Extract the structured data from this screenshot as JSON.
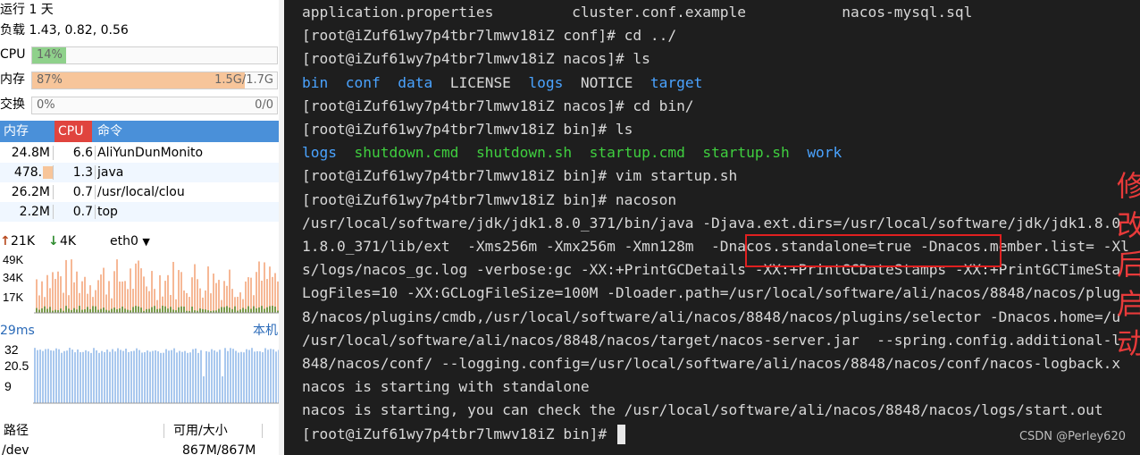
{
  "sysinfo": {
    "uptime": "运行 1 天",
    "load": "负载 1.43, 0.82, 0.56"
  },
  "meters": {
    "cpu": {
      "label": "CPU",
      "value": "14%",
      "fraction": 0.14,
      "color": "#8fd18b"
    },
    "mem": {
      "label": "内存",
      "value": "87%",
      "fraction": 0.87,
      "usage": "1.5G/1.7G",
      "color": "#f7c59a"
    },
    "swap": {
      "label": "交换",
      "value": "0%",
      "fraction": 0.0,
      "usage": "0/0",
      "color": "#cccccc"
    }
  },
  "processes": {
    "headers": {
      "mem": "内存",
      "cpu": "CPU",
      "cmd": "命令"
    },
    "rows": [
      {
        "mem": "24.8M",
        "cpu": "6.6",
        "cmd": "AliYunDunMonito"
      },
      {
        "mem": "478.5",
        "cpu": "1.3",
        "cmd": "java"
      },
      {
        "mem": "26.2M",
        "cpu": "0.7",
        "cmd": "/usr/local/clou"
      },
      {
        "mem": "2.2M",
        "cpu": "0.7",
        "cmd": "top"
      }
    ]
  },
  "network": {
    "up": "21K",
    "down": "4K",
    "interface": "eth0",
    "up_arrow_color": "#b84a1f",
    "down_arrow_color": "#2e8b2e",
    "y_ticks": [
      "49K",
      "34K",
      "17K"
    ]
  },
  "ping": {
    "latency": "29ms",
    "target": "本机",
    "y_ticks": [
      "32",
      "20.5",
      "9"
    ]
  },
  "disk": {
    "headers": {
      "path": "路径",
      "size": "可用/大小"
    },
    "row": {
      "path": "/dev",
      "size": "867M/867M"
    }
  },
  "terminal": {
    "lines": [
      {
        "segments": [
          {
            "t": "application.properties         cluster.conf.example           nacos-mysql.sql",
            "c": ""
          }
        ]
      },
      {
        "segments": [
          {
            "t": "[root@iZuf61wy7p4tbr7lmwv18iZ conf]# cd ../",
            "c": ""
          }
        ]
      },
      {
        "segments": [
          {
            "t": "[root@iZuf61wy7p4tbr7lmwv18iZ nacos]# ls",
            "c": ""
          }
        ]
      },
      {
        "segments": [
          {
            "t": "bin",
            "c": "c-blue"
          },
          {
            "t": "  ",
            "c": ""
          },
          {
            "t": "conf",
            "c": "c-blue"
          },
          {
            "t": "  ",
            "c": ""
          },
          {
            "t": "data",
            "c": "c-blue"
          },
          {
            "t": "  LICENSE  ",
            "c": ""
          },
          {
            "t": "logs",
            "c": "c-blue"
          },
          {
            "t": "  NOTICE  ",
            "c": ""
          },
          {
            "t": "target",
            "c": "c-blue"
          }
        ]
      },
      {
        "segments": [
          {
            "t": "[root@iZuf61wy7p4tbr7lmwv18iZ nacos]# cd bin/",
            "c": ""
          }
        ]
      },
      {
        "segments": [
          {
            "t": "[root@iZuf61wy7p4tbr7lmwv18iZ bin]# ls",
            "c": ""
          }
        ]
      },
      {
        "segments": [
          {
            "t": "logs",
            "c": "c-blue"
          },
          {
            "t": "  ",
            "c": ""
          },
          {
            "t": "shutdown.cmd",
            "c": "c-green"
          },
          {
            "t": "  ",
            "c": ""
          },
          {
            "t": "shutdown.sh",
            "c": "c-green"
          },
          {
            "t": "  ",
            "c": ""
          },
          {
            "t": "startup.cmd",
            "c": "c-green"
          },
          {
            "t": "  ",
            "c": ""
          },
          {
            "t": "startup.sh",
            "c": "c-green"
          },
          {
            "t": "  ",
            "c": ""
          },
          {
            "t": "work",
            "c": "c-blue"
          }
        ]
      },
      {
        "segments": [
          {
            "t": "[root@iZuf61wy7p4tbr7lmwv18iZ bin]# vim startup.sh",
            "c": ""
          }
        ]
      },
      {
        "segments": [
          {
            "t": "[root@iZuf61wy7p4tbr7lmwv18iZ bin]# nacoson",
            "c": ""
          }
        ]
      },
      {
        "segments": [
          {
            "t": "/usr/local/software/jdk/jdk1.8.0_371/bin/java -Djava.ext.dirs=/usr/local/software/jdk/jdk1.8.0",
            "c": ""
          }
        ]
      },
      {
        "segments": [
          {
            "t": "1.8.0_371/lib/ext  -Xms256m -Xmx256m -Xmn128m  -Dnacos.standalone=true -Dnacos.member.list= -Xl",
            "c": ""
          }
        ]
      },
      {
        "segments": [
          {
            "t": "s/logs/nacos_gc.log -verbose:gc -XX:+PrintGCDetails -XX:+PrintGCDateStamps -XX:+PrintGCTimeSta",
            "c": ""
          }
        ]
      },
      {
        "segments": [
          {
            "t": "LogFiles=10 -XX:GCLogFileSize=100M -Dloader.path=/usr/local/software/ali/nacos/8848/nacos/plug",
            "c": ""
          }
        ]
      },
      {
        "segments": [
          {
            "t": "8/nacos/plugins/cmdb,/usr/local/software/ali/nacos/8848/nacos/plugins/selector -Dnacos.home=/u",
            "c": ""
          }
        ]
      },
      {
        "segments": [
          {
            "t": "/usr/local/software/ali/nacos/8848/nacos/target/nacos-server.jar  --spring.config.additional-l",
            "c": ""
          }
        ]
      },
      {
        "segments": [
          {
            "t": "848/nacos/conf/ --logging.config=/usr/local/software/ali/nacos/8848/nacos/conf/nacos-logback.x",
            "c": ""
          }
        ]
      },
      {
        "segments": [
          {
            "t": "nacos is starting with standalone",
            "c": ""
          }
        ]
      },
      {
        "segments": [
          {
            "t": "nacos is starting, you can check the /usr/local/software/ali/nacos/8848/nacos/logs/start.out",
            "c": ""
          }
        ]
      },
      {
        "segments": [
          {
            "t": "[root@iZuf61wy7p4tbr7lmwv18iZ bin]# ",
            "c": ""
          }
        ],
        "cursor": true
      }
    ],
    "annotation": "修改后启动",
    "watermark": "CSDN @Perley620"
  },
  "colors": {
    "terminal_bg": "#1e1e1e",
    "terminal_fg": "#d8d8d8",
    "dir_blue": "#4aa3ff",
    "exec_green": "#3fcf3f",
    "annotation_red": "#e83a3a",
    "header_blue": "#4a90d9",
    "header_red": "#e0443e"
  }
}
